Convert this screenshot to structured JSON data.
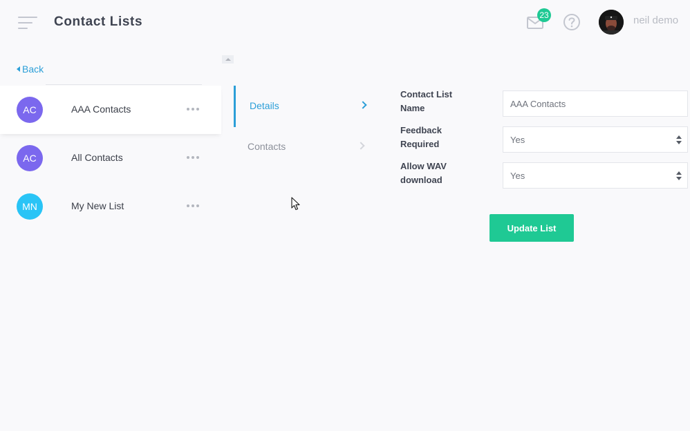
{
  "header": {
    "title": "Contact Lists",
    "notification_count": "23",
    "user_name": "neil demo"
  },
  "sidebar": {
    "back_label": "Back",
    "items": [
      {
        "initials": "AC",
        "name": "AAA Contacts",
        "color": "#7b68ee",
        "active": true
      },
      {
        "initials": "AC",
        "name": "All Contacts",
        "color": "#7b68ee",
        "active": false
      },
      {
        "initials": "MN",
        "name": "My New List",
        "color": "#29c4f6",
        "active": false
      }
    ]
  },
  "tabs": [
    {
      "label": "Details",
      "active": true
    },
    {
      "label": "Contacts",
      "active": false
    }
  ],
  "form": {
    "name_label": "Contact List Name",
    "name_value": "AAA Contacts",
    "feedback_label": "Feedback Required",
    "feedback_value": "Yes",
    "wav_label": "Allow WAV download",
    "wav_value": "Yes",
    "submit_label": "Update List"
  },
  "colors": {
    "accent_blue": "#2c9fd8",
    "accent_green": "#1fc994",
    "background": "#f9f9fb"
  }
}
